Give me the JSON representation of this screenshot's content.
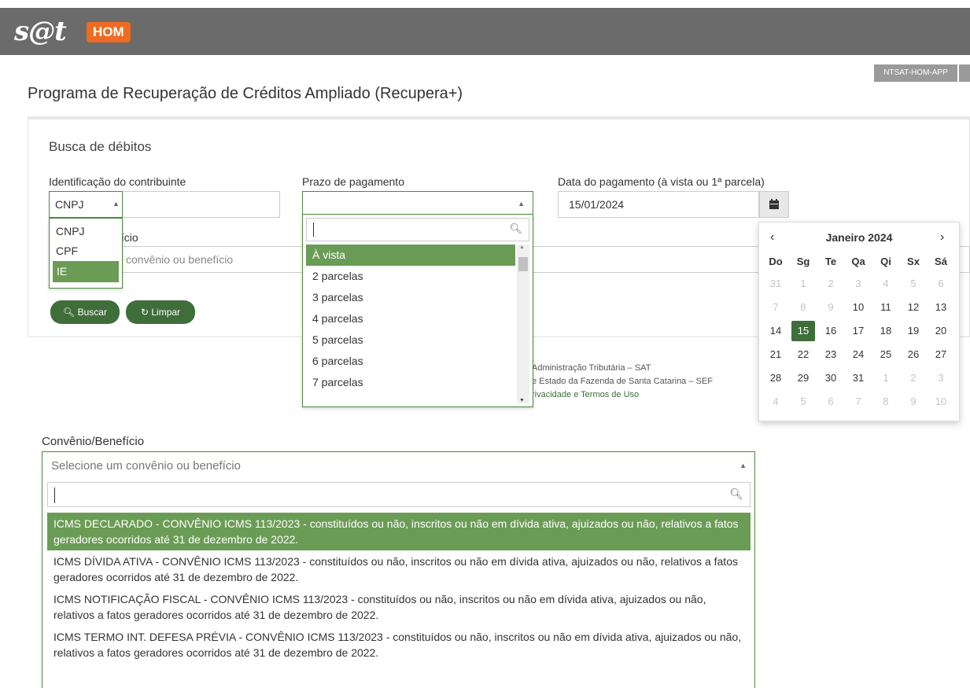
{
  "header": {
    "logo": "s@t",
    "env_badge": "HOM",
    "app_tag": "NTSAT-HOM-APP"
  },
  "page": {
    "title": "Programa de Recuperação de Créditos Ampliado (Recupera+)"
  },
  "form": {
    "section_title": "Busca de débitos",
    "id_label": "Identificação do contribuinte",
    "id_type_value": "CNPJ",
    "id_type_options": [
      "CNPJ",
      "CPF",
      "IE"
    ],
    "id_type_highlighted": "IE",
    "prazo_label": "Prazo de pagamento",
    "prazo_options": [
      "À vista",
      "2 parcelas",
      "3 parcelas",
      "4 parcelas",
      "5 parcelas",
      "6 parcelas",
      "7 parcelas"
    ],
    "data_label": "Data do pagamento (à vista ou 1ª parcela)",
    "data_value": "15/01/2024",
    "conv_label_partial": "fício",
    "conv_placeholder_partial": "convênio ou benefício",
    "buscar_label": "Buscar",
    "limpar_label": "Limpar"
  },
  "footer": {
    "line1": "Administração Tributária – SAT",
    "line2": "e Estado da Fazenda de Santa Catarina – SEF",
    "line3": "rivacidade e Termos de Uso"
  },
  "calendar": {
    "month_label": "Janeiro 2024",
    "prev_icon": "‹",
    "next_icon": "›",
    "weekdays": [
      "Do",
      "Sg",
      "Te",
      "Qa",
      "Qi",
      "Sx",
      "Sá"
    ],
    "selected_day": "15",
    "weeks": [
      [
        "31",
        "1",
        "2",
        "3",
        "4",
        "5",
        "6"
      ],
      [
        "7",
        "8",
        "9",
        "10",
        "11",
        "12",
        "13"
      ],
      [
        "14",
        "15",
        "16",
        "17",
        "18",
        "19",
        "20"
      ],
      [
        "21",
        "22",
        "23",
        "24",
        "25",
        "26",
        "27"
      ],
      [
        "28",
        "29",
        "30",
        "31",
        "1",
        "2",
        "3"
      ],
      [
        "4",
        "5",
        "6",
        "7",
        "8",
        "9",
        "10"
      ]
    ]
  },
  "convenio": {
    "label": "Convênio/Benefício",
    "placeholder": "Selecione um convênio ou benefício",
    "items": [
      {
        "bold": "ICMS DECLARADO - CONVÊNIO ICMS 113/2023",
        "rest": " - constituídos ou não, inscritos ou não em dívida ativa, ajuizados ou não, relativos a fatos geradores ocorridos até 31 de dezembro de 2022."
      },
      {
        "bold": "ICMS DÍVIDA ATIVA - CONVÊNIO ICMS 113/2023",
        "rest": " - constituídos ou não, inscritos ou não em dívida ativa, ajuizados ou não, relativos a fatos geradores ocorridos até 31 de dezembro de 2022."
      },
      {
        "bold": "ICMS NOTIFICAÇÃO FISCAL - CONVÊNIO ICMS 113/2023",
        "rest": " - constituídos ou não, inscritos ou não em dívida ativa, ajuizados ou não, relativos a fatos geradores ocorridos até 31 de dezembro de 2022."
      },
      {
        "bold": "ICMS TERMO INT. DEFESA PRÉVIA - CONVÊNIO ICMS 113/2023",
        "rest": " - constituídos ou não, inscritos ou não em dívida ativa, ajuizados ou não, relativos a fatos geradores ocorridos até 31 de dezembro de 2022."
      }
    ]
  },
  "colors": {
    "header_bg": "#6b6b6b",
    "brand_orange": "#ef6b21",
    "accent_green": "#3f6e3a",
    "highlight_green": "#6b9c55"
  }
}
